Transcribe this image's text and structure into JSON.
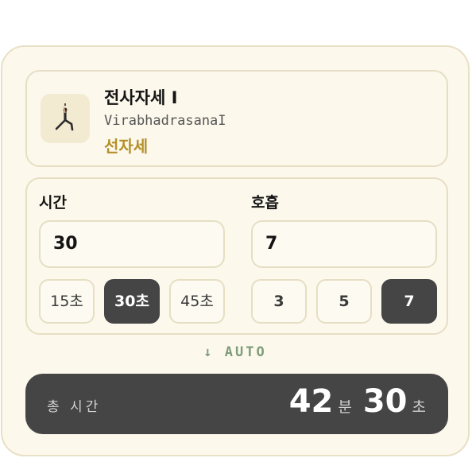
{
  "pose": {
    "name": "전사자세 I",
    "sanskrit": "VirabhadrasanaI",
    "category": "선자세",
    "thumbnail_icon": "warrior-pose-figure",
    "accent_color": "#b39029"
  },
  "duration": {
    "label": "시간",
    "value": "30",
    "options": [
      "15초",
      "30초",
      "45초"
    ],
    "selected": "30초"
  },
  "breath": {
    "label": "호흡",
    "value": "7",
    "options": [
      "3",
      "5",
      "7"
    ],
    "selected": "7"
  },
  "auto_label": "↓ AUTO",
  "total": {
    "label": "총 시간",
    "minutes": "42",
    "minutes_unit": "분",
    "seconds": "30",
    "seconds_unit": "초"
  },
  "colors": {
    "card_bg": "#fcf8ec",
    "dark": "#454545",
    "auto": "#7e9c7a"
  }
}
